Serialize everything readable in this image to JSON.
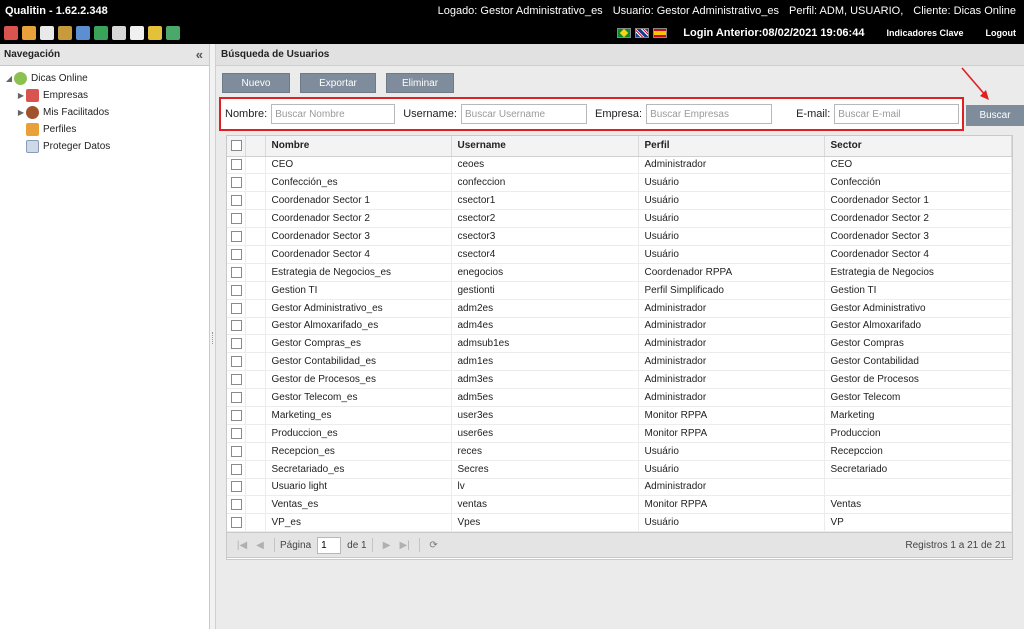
{
  "titlebar": {
    "app": "Qualitin - 1.62.2.348",
    "logado": "Logado: Gestor Administrativo_es",
    "usuario": "Usuario: Gestor Administrativo_es",
    "perfil": "Perfil: ADM, USUARIO,",
    "cliente": "Cliente: Dicas Online"
  },
  "toolbar": {
    "login_anterior": "Login Anterior:08/02/2021 19:06:44",
    "indicadores": "Indicadores Clave",
    "logout": "Logout",
    "flags": [
      "br-flag",
      "uk-flag",
      "es-flag"
    ]
  },
  "sidebar": {
    "title": "Navegación",
    "collapse_glyph": "«",
    "items": [
      {
        "label": "Dicas Online",
        "icon": "users-group-icon",
        "expandable": true
      },
      {
        "label": "Empresas",
        "icon": "company-icon",
        "expandable": true
      },
      {
        "label": "Mis Facilitados",
        "icon": "user-icon",
        "expandable": true
      },
      {
        "label": "Perfiles",
        "icon": "profiles-icon",
        "expandable": false
      },
      {
        "label": "Proteger Datos",
        "icon": "protect-data-icon",
        "expandable": false
      }
    ]
  },
  "main": {
    "title": "Búsqueda de Usuarios",
    "buttons": {
      "nuevo": "Nuevo",
      "exportar": "Exportar",
      "eliminar": "Eliminar",
      "buscar": "Buscar"
    },
    "search": {
      "nombre_label": "Nombre:",
      "nombre_placeholder": "Buscar Nombre",
      "username_label": "Username:",
      "username_placeholder": "Buscar Username",
      "empresa_label": "Empresa:",
      "empresa_placeholder": "Buscar Empresas",
      "email_label": "E-mail:",
      "email_placeholder": "Buscar E-mail"
    },
    "grid": {
      "columns": [
        "Nombre",
        "Username",
        "Perfil",
        "Sector"
      ],
      "rows": [
        [
          "CEO",
          "ceoes",
          "Administrador",
          "CEO"
        ],
        [
          "Confección_es",
          "confeccion",
          "Usuário",
          "Confección"
        ],
        [
          "Coordenador Sector 1",
          "csector1",
          "Usuário",
          "Coordenador Sector 1"
        ],
        [
          "Coordenador Sector 2",
          "csector2",
          "Usuário",
          "Coordenador Sector 2"
        ],
        [
          "Coordenador Sector 3",
          "csector3",
          "Usuário",
          "Coordenador Sector 3"
        ],
        [
          "Coordenador Sector 4",
          "csector4",
          "Usuário",
          "Coordenador Sector 4"
        ],
        [
          "Estrategia de Negocios_es",
          "enegocios",
          "Coordenador RPPA",
          "Estrategia de Negocios"
        ],
        [
          "Gestion TI",
          "gestionti",
          "Perfil Simplificado",
          "Gestion TI"
        ],
        [
          "Gestor Administrativo_es",
          "adm2es",
          "Administrador",
          "Gestor Administrativo"
        ],
        [
          "Gestor Almoxarifado_es",
          "adm4es",
          "Administrador",
          "Gestor Almoxarifado"
        ],
        [
          "Gestor Compras_es",
          "admsub1es",
          "Administrador",
          "Gestor Compras"
        ],
        [
          "Gestor Contabilidad_es",
          "adm1es",
          "Administrador",
          "Gestor Contabilidad"
        ],
        [
          "Gestor de Procesos_es",
          "adm3es",
          "Administrador",
          "Gestor de Procesos"
        ],
        [
          "Gestor Telecom_es",
          "adm5es",
          "Administrador",
          "Gestor Telecom"
        ],
        [
          "Marketing_es",
          "user3es",
          "Monitor RPPA",
          "Marketing"
        ],
        [
          "Produccion_es",
          "user6es",
          "Monitor RPPA",
          "Produccion"
        ],
        [
          "Recepcion_es",
          "reces",
          "Usuário",
          "Recepccion"
        ],
        [
          "Secretariado_es",
          "Secres",
          "Usuário",
          "Secretariado"
        ],
        [
          "Usuario light",
          "lv",
          "Administrador",
          ""
        ],
        [
          "Ventas_es",
          "ventas",
          "Monitor RPPA",
          "Ventas"
        ],
        [
          "VP_es",
          "Vpes",
          "Usuário",
          "VP"
        ]
      ]
    },
    "pager": {
      "pagina_label": "Página",
      "page_value": "1",
      "de_label": "de 1",
      "registros": "Registros 1 a 21 de 21"
    }
  }
}
